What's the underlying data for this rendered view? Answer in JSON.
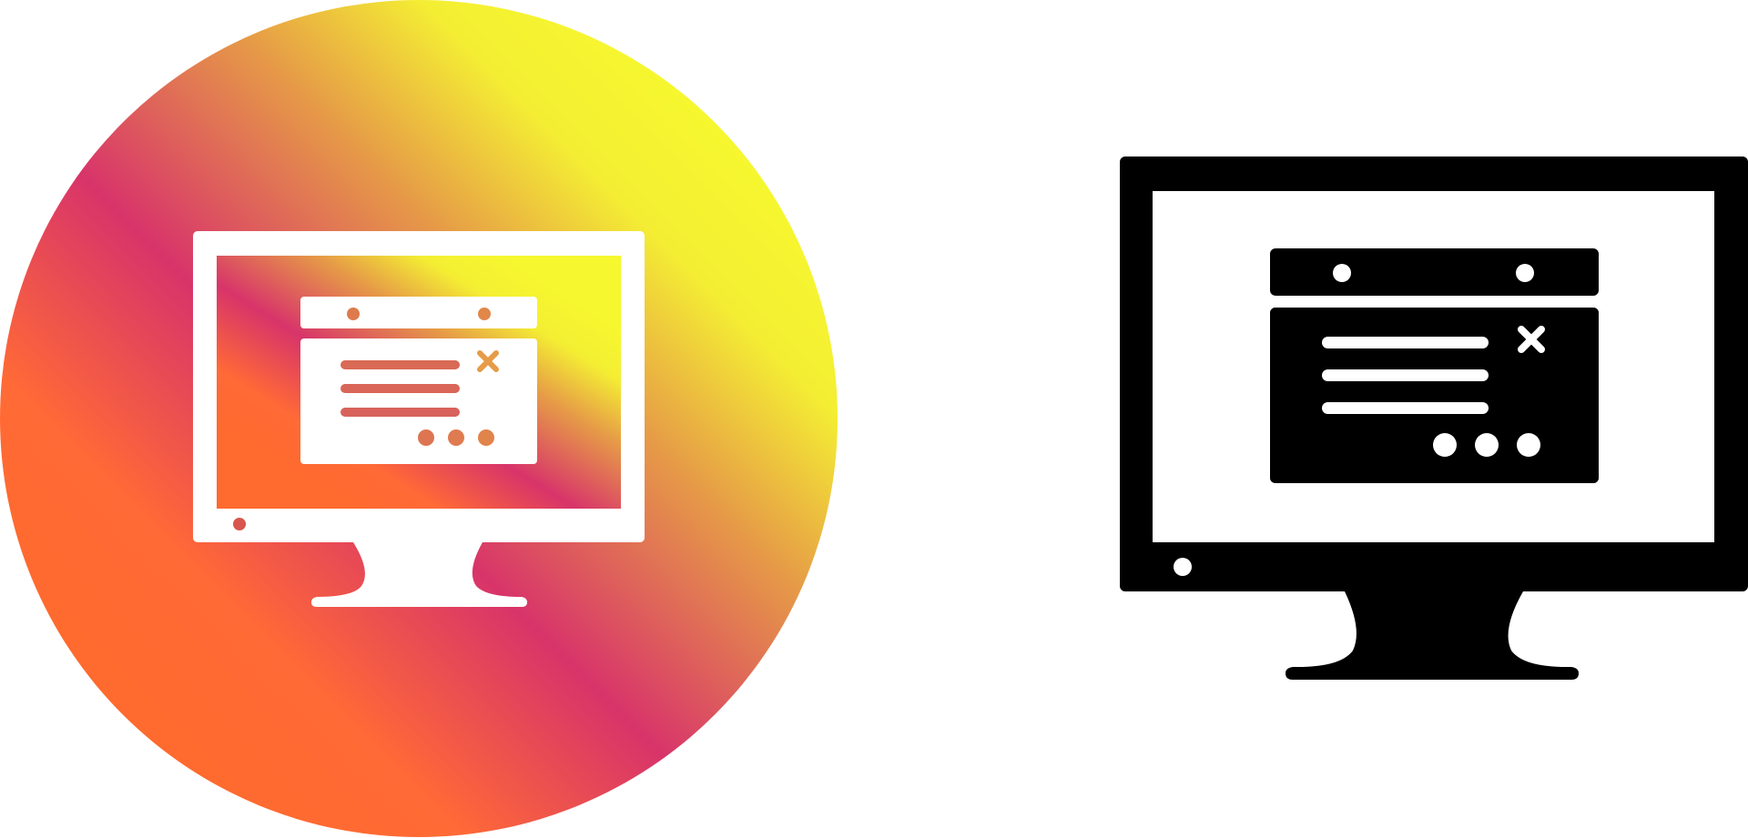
{
  "icons": [
    {
      "name": "monitor-with-dialog-icon",
      "style": "gradient-circle",
      "gradient_colors": [
        "#ff6a2e",
        "#d8346a",
        "#e38d4a",
        "#f6f22f"
      ],
      "foreground": "#ffffff"
    },
    {
      "name": "monitor-with-dialog-icon",
      "style": "glyph",
      "foreground": "#000000",
      "background": "#ffffff"
    }
  ]
}
